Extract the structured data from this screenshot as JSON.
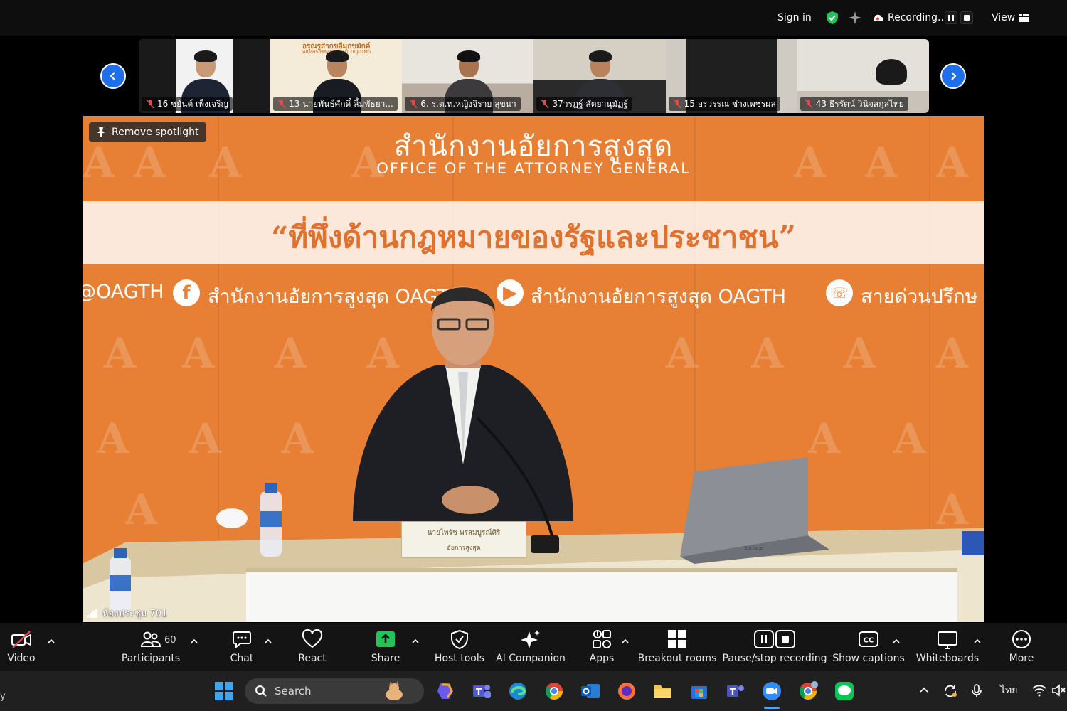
{
  "topbar": {
    "sign_in": "Sign in",
    "recording": "Recording...",
    "view": "View"
  },
  "thumbnails": [
    {
      "name": "16 ชยันต์ เพ็งเจริญ"
    },
    {
      "name": "13 นายพันธ์ศักดิ์ ลิ้มพัธยา..."
    },
    {
      "name": "6. ร.ต.ท.หญิงจิราย สุขนา"
    },
    {
      "name": "37วรฎฐ์ สัตยานุมัฏฐ์"
    },
    {
      "name": "15 อรวรรณ ช่างเพชรผล"
    },
    {
      "name": "43 ธีรรัตน์ วินิจสกุลไทย"
    }
  ],
  "thumb_sign_text": "อรุณรูสากขอืมุกขมักค์",
  "thumb_sign_sub": "JARMHS PMMOTH SHT 10 JOTMG",
  "main_video": {
    "remove_spotlight": "Remove spotlight",
    "banner_title": "สำนักงานอัยการสูงสุด",
    "banner_subtitle": "OFFICE OF THE ATTORNEY GENERAL",
    "slogan": "“ที่พึ่งด้านกฎหมายของรัฐและประชาชน”",
    "social_1": "@OAGTH",
    "social_2": "สำนักงานอัยการสูงสุด OAGTH",
    "social_3": "สำนักงานอัยการสูงสุด OAGTH",
    "social_4": "สายด่วนปรึกษ",
    "nameplate_name": "นายไพรัช พรสมบูรณ์ศิริ",
    "nameplate_title": "อัยการสูงสุด",
    "laptop_brand": "Surface",
    "room_label": "ห้องประชุม 701"
  },
  "toolbar": {
    "video": "Video",
    "participants": "Participants",
    "participants_count": "60",
    "chat": "Chat",
    "react": "React",
    "share": "Share",
    "host_tools": "Host tools",
    "ai_companion": "AI Companion",
    "apps": "Apps",
    "breakout_rooms": "Breakout rooms",
    "pause_stop_recording": "Pause/stop recording",
    "show_captions": "Show captions",
    "whiteboards": "Whiteboards",
    "more": "More"
  },
  "taskbar": {
    "search_placeholder": "Search",
    "language": "ไทย",
    "left_clip": "y"
  },
  "colors": {
    "accent_blue": "#1f6feb",
    "share_green": "#23c35a",
    "banner_orange": "#e77f35",
    "mic_off_red": "#e5484d"
  }
}
